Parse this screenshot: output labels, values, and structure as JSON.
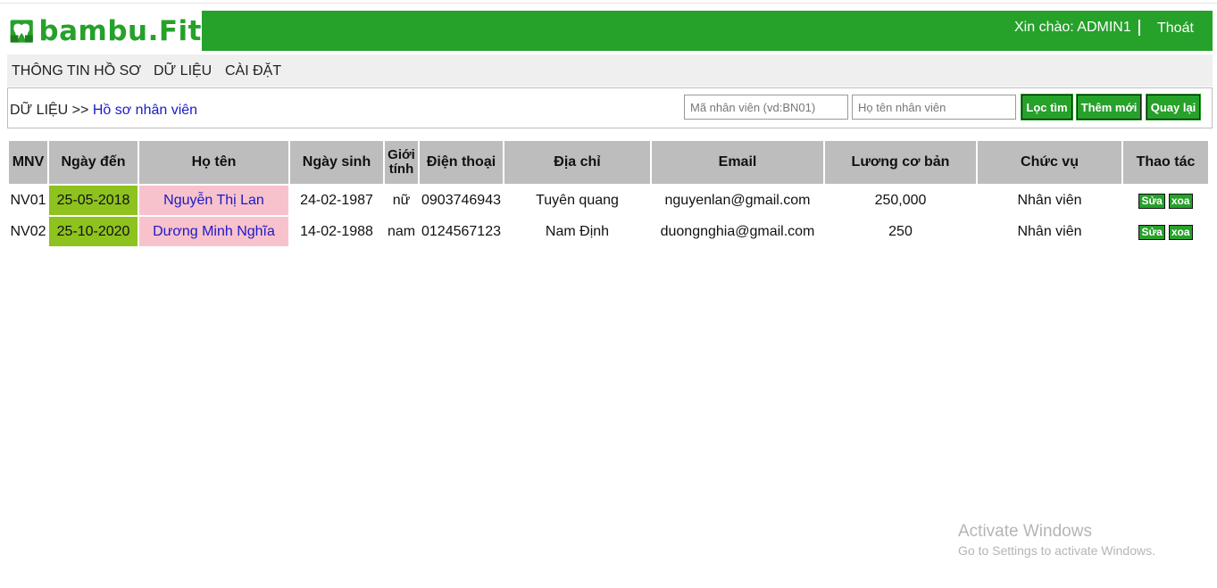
{
  "brand": {
    "name_part1": "bambu.",
    "name_part2": "Fit",
    "green": "#26a12a"
  },
  "header": {
    "greeting": "Xin chào: ADMIN1",
    "logout": "Thoát"
  },
  "menu": [
    "THÔNG TIN HỒ SƠ",
    "DỮ LIỆU",
    "CÀI ĐẶT"
  ],
  "breadcrumb": {
    "root": "DỮ LIỆU >>",
    "current": "Hồ sơ nhân viên"
  },
  "search": {
    "id_placeholder": "Mã nhân viên (vd:BN01)",
    "name_placeholder": "Họ tên nhân viên",
    "filter_label": "Lọc tìm",
    "add_label": "Thêm mới",
    "back_label": "Quay lại"
  },
  "table": {
    "headers": [
      "MNV",
      "Ngày đến",
      "Họ tên",
      "Ngày sinh",
      "Giới tính",
      "Điện thoại",
      "Địa chỉ",
      "Email",
      "Lương cơ bản",
      "Chức vụ",
      "Thao tác"
    ],
    "rows": [
      {
        "mnv": "NV01",
        "ngay_den": "25-05-2018",
        "ho_ten": "Nguyễn Thị Lan",
        "ngay_sinh": "24-02-1987",
        "gioi_tinh": "nữ",
        "dien_thoai": "0903746943",
        "dia_chi": "Tuyên quang",
        "email": "nguyenlan@gmail.com",
        "luong": "250,000",
        "chuc_vu": "Nhân viên"
      },
      {
        "mnv": "NV02",
        "ngay_den": "25-10-2020",
        "ho_ten": "Dương Minh Nghĩa",
        "ngay_sinh": "14-02-1988",
        "gioi_tinh": "nam",
        "dien_thoai": "0124567123",
        "dia_chi": "Nam Định",
        "email": "duongnghia@gmail.com",
        "luong": "250",
        "chuc_vu": "Nhân viên"
      }
    ],
    "edit_label": "Sửa",
    "delete_label": "xoa",
    "colors": {
      "header_bg": "#bdbdbd",
      "date_bg": "#8dc21f",
      "name_bg": "#f8c2cc",
      "name_text": "#1a1ac8"
    }
  },
  "watermark": {
    "title": "Activate Windows",
    "subtitle": "Go to Settings to activate Windows."
  }
}
